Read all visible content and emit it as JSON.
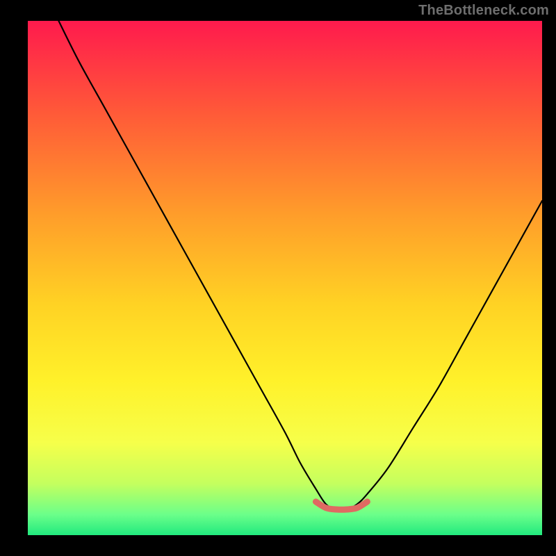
{
  "watermark": "TheBottleneck.com",
  "colors": {
    "black": "#000000",
    "curve": "#000000",
    "highlight": "#df6a62",
    "gradient": [
      "#ff1a4d",
      "#ff5a38",
      "#ff9e2a",
      "#ffd224",
      "#fff12a",
      "#f6ff4a",
      "#c4ff5e",
      "#6bff8a",
      "#21e97e"
    ]
  },
  "chart_data": {
    "type": "line",
    "title": "",
    "xlabel": "",
    "ylabel": "",
    "xlim": [
      0,
      100
    ],
    "ylim": [
      0,
      100
    ],
    "grid": false,
    "legend": false,
    "annotations": [],
    "series": [
      {
        "name": "curve",
        "x": [
          6,
          10,
          15,
          20,
          25,
          30,
          35,
          40,
          45,
          50,
          53,
          56,
          58,
          60,
          62,
          64,
          66,
          70,
          75,
          80,
          85,
          90,
          95,
          100
        ],
        "y": [
          100,
          92,
          83,
          74,
          65,
          56,
          47,
          38,
          29,
          20,
          14,
          9,
          6,
          5,
          5,
          6,
          8,
          13,
          21,
          29,
          38,
          47,
          56,
          65
        ]
      },
      {
        "name": "valley-highlight",
        "x": [
          56,
          58,
          60,
          62,
          64,
          66
        ],
        "y": [
          6.5,
          5.3,
          5.0,
          5.0,
          5.3,
          6.5
        ]
      }
    ]
  }
}
